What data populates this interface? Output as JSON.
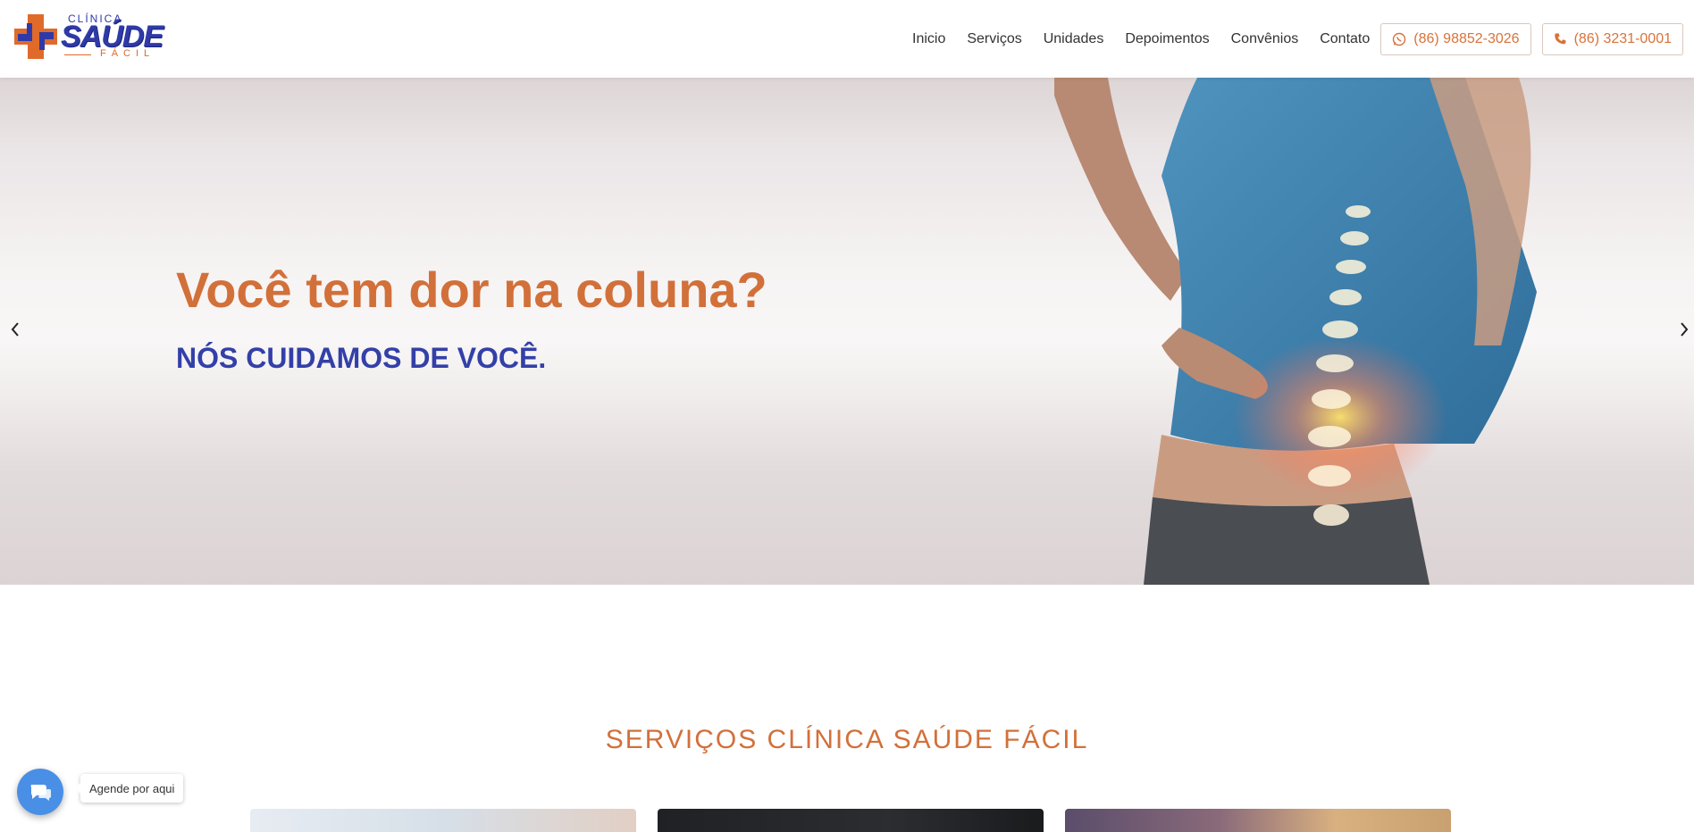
{
  "header": {
    "logo": {
      "small": "CLÍNICA",
      "big": "SAÚDE",
      "sub": "FÁCIL"
    },
    "nav": [
      {
        "label": "Inicio"
      },
      {
        "label": "Serviços"
      },
      {
        "label": "Unidades"
      },
      {
        "label": "Depoimentos"
      },
      {
        "label": "Convênios"
      },
      {
        "label": "Contato"
      }
    ],
    "whatsapp": {
      "icon": "whatsapp-icon",
      "label": "(86) 98852-3026"
    },
    "phone": {
      "icon": "phone-icon",
      "label": "(86) 3231-0001"
    }
  },
  "hero": {
    "title": "Você tem dor na coluna?",
    "subtitle": "NÓS CUIDAMOS DE VOCÊ.",
    "prev_icon": "chevron-left-icon",
    "next_icon": "chevron-right-icon"
  },
  "services": {
    "title": "SERVIÇOS CLÍNICA SAÚDE FÁCIL"
  },
  "chat": {
    "icon": "chat-icon",
    "label": "Agende por aqui"
  },
  "colors": {
    "accent_orange": "#d2703a",
    "brand_blue": "#3340a8",
    "chat_blue": "#4a8fe6"
  }
}
